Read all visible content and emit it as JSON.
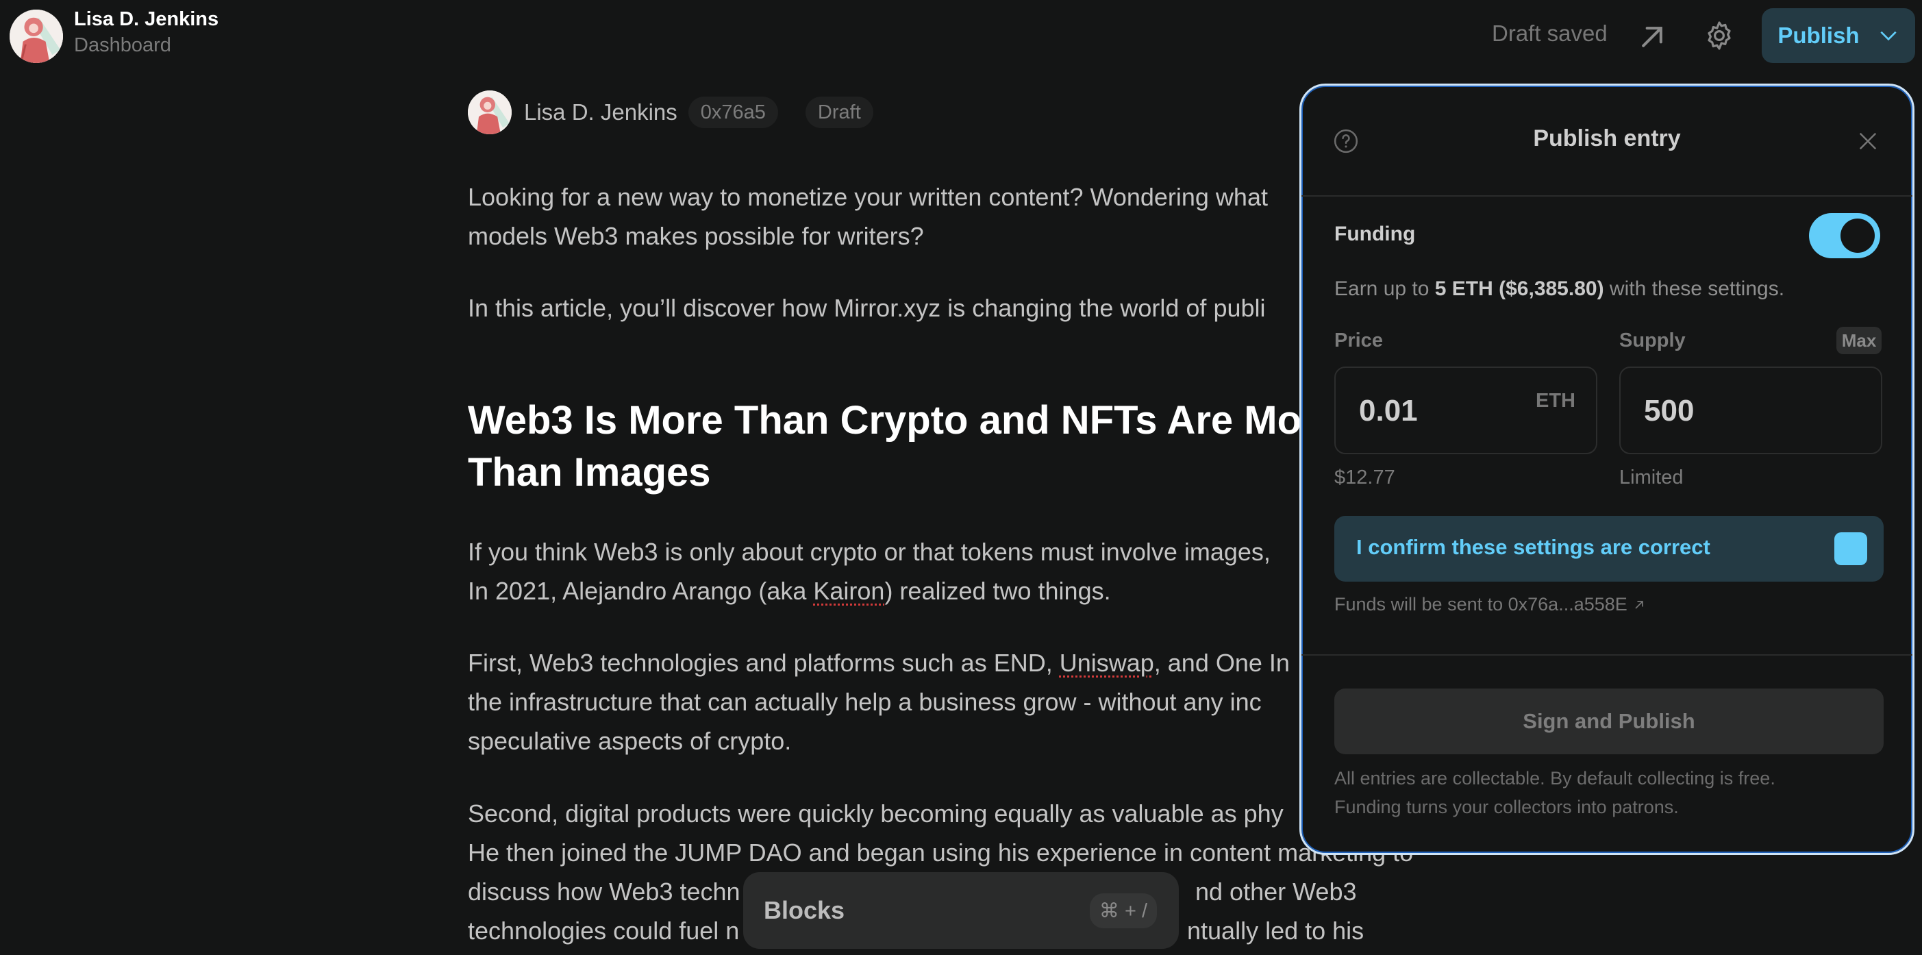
{
  "header": {
    "user_name": "Lisa D. Jenkins",
    "subtitle": "Dashboard",
    "status": "Draft saved",
    "publish_label": "Publish",
    "icons": [
      "avatar",
      "external-link-icon",
      "gear-icon",
      "chevron-down-icon"
    ]
  },
  "byline": {
    "author": "Lisa D. Jenkins",
    "address_badge": "0x76a5",
    "status_badge": "Draft"
  },
  "article": {
    "p1_line1": "Looking for a new way to monetize your written content? Wondering what",
    "p1_line2": "models Web3 makes possible for writers?",
    "p2_line1": "In this article, you’ll discover how Mirror.xyz is changing the world of publi",
    "heading_line1": "Web3 Is More Than Crypto and NFTs Are Mo",
    "heading_line2": "Than Images",
    "p3_line1": "If you think Web3 is only about crypto or that tokens must involve images,",
    "p3_line2_a": "In 2021, Alejandro Arango (aka ",
    "p3_line2_spell": "Kairon",
    "p3_line2_b": ") realized two things.",
    "p4_line1_a": "First, Web3 technologies and platforms such as END, ",
    "p4_line1_spell": "Uniswap",
    "p4_line1_b": ", and One In",
    "p4_line2": "the infrastructure that can actually help a business grow - without any inc",
    "p4_line3": "speculative aspects of crypto.",
    "p5_line1": "Second, digital products were quickly becoming equally as valuable as phy",
    "p5_line2": "He then joined the JUMP DAO and began using his experience in content marketing to",
    "p5_line3_a": "discuss how Web3 techn",
    "p5_line3_b": "nd other Web3",
    "p5_line4_a": "technologies could fuel n",
    "p5_line4_b": "ntually led to his"
  },
  "blocks_menu": {
    "label": "Blocks",
    "shortcut": "⌘ + /"
  },
  "publish_panel": {
    "title": "Publish entry",
    "funding_label": "Funding",
    "funding_enabled": true,
    "earn_prefix": "Earn up to ",
    "earn_amount": "5 ETH ($6,385.80)",
    "earn_suffix": " with these settings.",
    "price_label": "Price",
    "price_value": "0.01",
    "price_unit": "ETH",
    "price_usd": "$12.77",
    "supply_label": "Supply",
    "supply_max_label": "Max",
    "supply_value": "500",
    "supply_sub": "Limited",
    "confirm_label": "I confirm these settings are correct",
    "confirm_checked": true,
    "funds_text": "Funds will be sent to 0x76a...a558E",
    "sign_button": "Sign and Publish",
    "footnote_line1": "All entries are collectable. By default collecting is free.",
    "footnote_line2": "Funding turns your collectors into patrons."
  },
  "colors": {
    "background": "#141515",
    "accent": "#62cdf9",
    "accent_bg": "#243a44",
    "panel_border": "#cfe4f7"
  }
}
